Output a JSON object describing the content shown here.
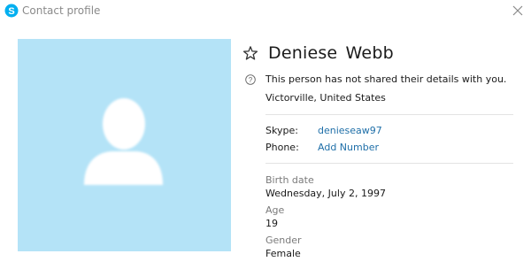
{
  "window": {
    "title": "Contact profile"
  },
  "profile": {
    "name": "Deniese  Webb",
    "notice": "This person has not shared their details with you.",
    "location": "Victorville, United States",
    "skype_label": "Skype:",
    "skype_value": "denieseaw97",
    "phone_label": "Phone:",
    "phone_value": "Add Number",
    "birth_label": "Birth date",
    "birth_value": "Wednesday, July 2, 1997",
    "age_label": "Age",
    "age_value": "19",
    "gender_label": "Gender",
    "gender_value": "Female"
  },
  "colors": {
    "avatar_bg": "#b4e3f7",
    "link": "#1f6fa8",
    "skype_blue": "#00aff0"
  },
  "icons": {
    "app": "skype-logo-icon",
    "close": "close-icon",
    "favorite": "star-outline-icon",
    "info": "question-circle-icon",
    "avatar": "default-person-icon"
  }
}
